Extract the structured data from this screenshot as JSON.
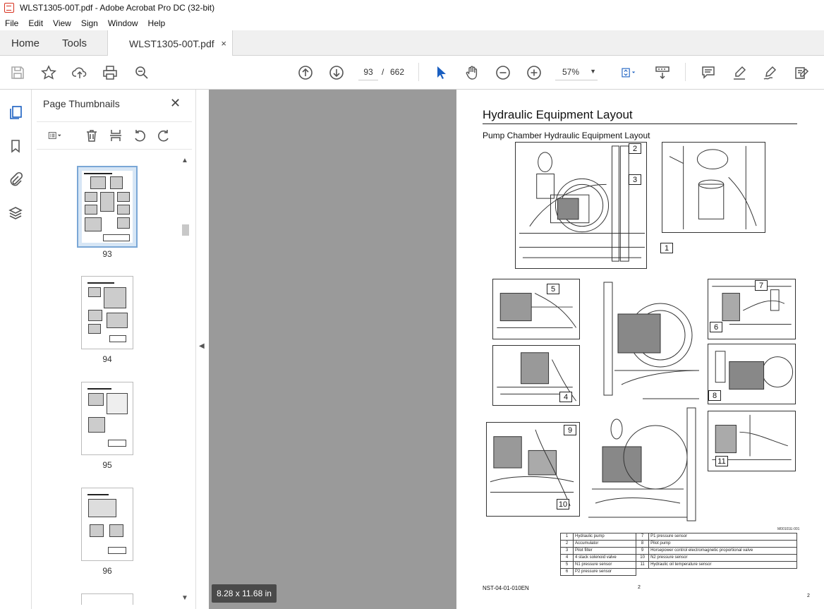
{
  "window": {
    "title": "WLST1305-00T.pdf - Adobe Acrobat Pro DC (32-bit)"
  },
  "menu": [
    "File",
    "Edit",
    "View",
    "Sign",
    "Window",
    "Help"
  ],
  "tabs": {
    "home": "Home",
    "tools": "Tools",
    "document": "WLST1305-00T.pdf",
    "close_glyph": "×"
  },
  "toolbar": {
    "current_page": "93",
    "page_separator": "/",
    "total_pages": "662",
    "zoom": "57%",
    "icons": [
      "save-icon",
      "bookmark-star-icon",
      "upload-icon",
      "print-icon",
      "find-icon",
      "page-up-icon",
      "page-down-icon",
      "select-arrow-icon",
      "hand-icon",
      "zoom-out-icon",
      "zoom-in-icon",
      "fit-page-icon",
      "scroll-mode-icon",
      "comment-icon",
      "highlight-icon",
      "sign-icon",
      "edit-icon"
    ]
  },
  "thumbnail_panel": {
    "title": "Page Thumbnails",
    "close_glyph": "✕",
    "thumbnails": [
      {
        "label": "93",
        "selected": true
      },
      {
        "label": "94",
        "selected": false
      },
      {
        "label": "95",
        "selected": false
      },
      {
        "label": "96",
        "selected": false
      }
    ]
  },
  "status": {
    "page_size": "8.28 x 11.68 in"
  },
  "document": {
    "title": "Hydraulic Equipment Layout",
    "subtitle": "Pump Chamber Hydraulic Equipment Layout",
    "callouts": [
      "1",
      "2",
      "3",
      "4",
      "5",
      "6",
      "7",
      "8",
      "9",
      "10",
      "11"
    ],
    "figure_id": "M00101E-001",
    "legend": [
      {
        "num": "1",
        "name": "Hydraulic pump",
        "num2": "7",
        "name2": "P1 pressure sensor"
      },
      {
        "num": "2",
        "name": "Accumulator",
        "num2": "8",
        "name2": "Pilot pump"
      },
      {
        "num": "3",
        "name": "Pilot filter",
        "num2": "9",
        "name2": "Horsepower control electromagnetic proportional valve"
      },
      {
        "num": "4",
        "name": "4 stack solenoid valve",
        "num2": "10",
        "name2": "N2 pressure sensor"
      },
      {
        "num": "5",
        "name": "N1 pressure sensor",
        "num2": "11",
        "name2": "Hydraulic oil temperature sensor"
      },
      {
        "num": "6",
        "name": "P2 pressure sensor",
        "num2": "",
        "name2": ""
      }
    ],
    "footer_code": "NST-04-01-010EN",
    "page_num_center": "2",
    "page_num_right": "2"
  }
}
